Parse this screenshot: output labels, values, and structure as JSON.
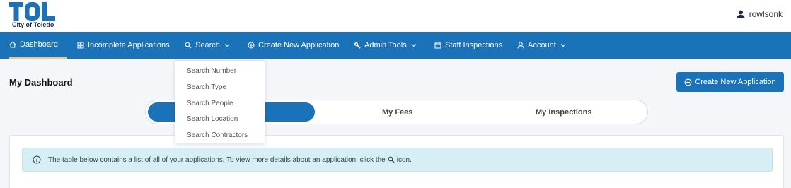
{
  "brand": {
    "logo_text": "TOL",
    "subtitle": "City of Toledo",
    "color": "#1a72b8"
  },
  "user": {
    "name": "rowlsonk",
    "icon": "user-icon"
  },
  "nav": {
    "items": [
      {
        "label": "Dashboard",
        "icon": "home-icon"
      },
      {
        "label": "Incomplete Applications",
        "icon": "grid-icon"
      },
      {
        "label": "Search",
        "icon": "search-icon"
      },
      {
        "label": "Create New Application",
        "icon": "plus-circle-icon"
      },
      {
        "label": "Admin Tools",
        "icon": "wrench-icon"
      },
      {
        "label": "Staff Inspections",
        "icon": "calendar-icon"
      },
      {
        "label": "Account",
        "icon": "user-icon"
      }
    ]
  },
  "search_menu": {
    "options": [
      "Search Number",
      "Search Type",
      "Search People",
      "Search Location",
      "Search Contractors"
    ]
  },
  "main": {
    "title": "My Dashboard",
    "create_button": "Create New Application",
    "tabs": [
      "",
      "My Fees",
      "My Inspections"
    ],
    "info_text_before": "The table below contains a list of all of your applications. To view more details about an application, click the",
    "info_text_after": "icon."
  },
  "colors": {
    "nav_bg": "#1a72b8",
    "active_underline": "#e8c98a",
    "alert_bg": "#d6eef4"
  }
}
